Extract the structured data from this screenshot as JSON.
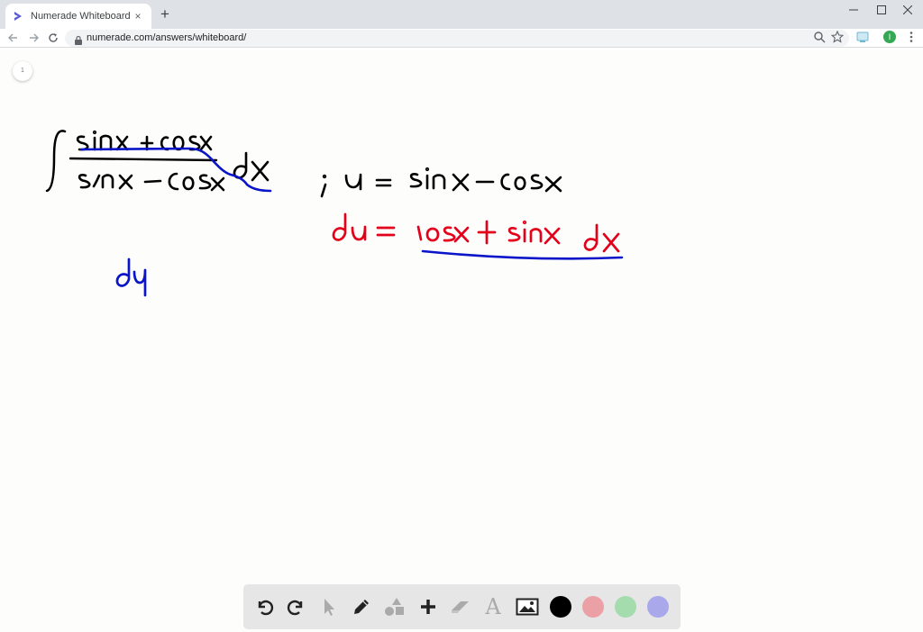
{
  "browser": {
    "tab_title": "Numerade Whiteboard",
    "tab_close": "×",
    "new_tab": "+",
    "url": "numerade.com/answers/whiteboard/",
    "profile_initial": "I"
  },
  "whiteboard": {
    "page_number": "1",
    "ink": {
      "black_text": [
        "sinx + cosx",
        "sinx − cosx",
        "dx",
        "; u = sinx − cosx"
      ],
      "red_text": [
        "du = cosx + sinx dx"
      ],
      "blue_text": [
        "du"
      ]
    },
    "colors": {
      "black_ink": "#000000",
      "red_ink": "#e3001b",
      "blue_ink": "#0a14c8"
    },
    "tools": [
      {
        "name": "undo",
        "icon": "undo-icon"
      },
      {
        "name": "redo",
        "icon": "redo-icon"
      },
      {
        "name": "select",
        "icon": "pointer-icon"
      },
      {
        "name": "pen",
        "icon": "pencil-icon"
      },
      {
        "name": "shapes",
        "icon": "shapes-icon"
      },
      {
        "name": "add",
        "icon": "plus-icon"
      },
      {
        "name": "eraser",
        "icon": "eraser-icon"
      },
      {
        "name": "text",
        "icon": "text-icon",
        "label": "A"
      },
      {
        "name": "image",
        "icon": "image-icon"
      }
    ],
    "swatches": [
      "#000000",
      "#eba0a5",
      "#a5dcae",
      "#a8a8ea"
    ]
  }
}
